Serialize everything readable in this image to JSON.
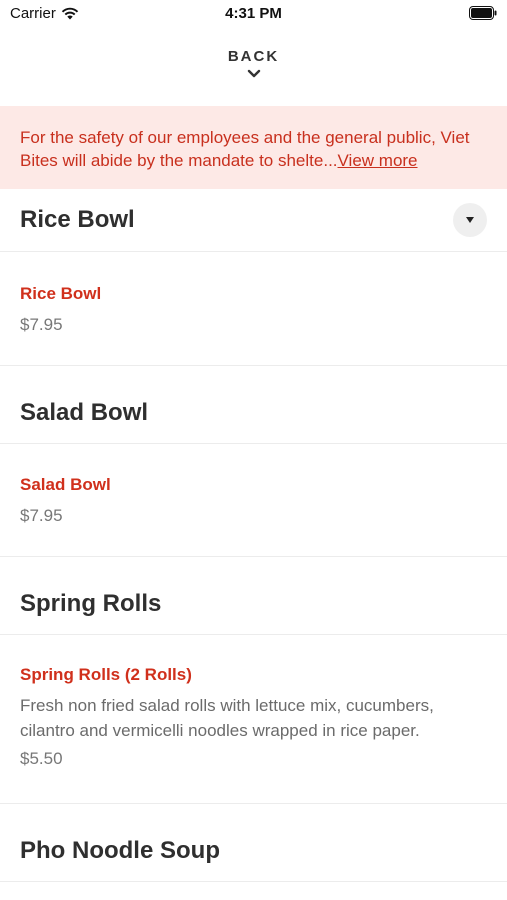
{
  "status_bar": {
    "carrier": "Carrier",
    "time": "4:31 PM"
  },
  "header": {
    "back_label": "BACK"
  },
  "notice": {
    "text": "For the safety of our employees and the general public, Viet Bites will abide by the mandate to shelte...",
    "link_label": "View more"
  },
  "sections": [
    {
      "title": "Rice Bowl",
      "items": [
        {
          "name": "Rice Bowl",
          "price": "$7.95"
        }
      ]
    },
    {
      "title": "Salad Bowl",
      "items": [
        {
          "name": "Salad Bowl",
          "price": "$7.95"
        }
      ]
    },
    {
      "title": "Spring Rolls",
      "items": [
        {
          "name": "Spring Rolls (2 Rolls)",
          "description": "Fresh non fried salad rolls with lettuce mix, cucumbers, cilantro and vermicelli noodles wrapped in rice paper.",
          "price": "$5.50"
        }
      ]
    },
    {
      "title": "Pho Noodle Soup",
      "items": []
    }
  ],
  "colors": {
    "accent": "#d0301c",
    "notice_bg": "#fde9e6",
    "divider": "#ececec"
  }
}
